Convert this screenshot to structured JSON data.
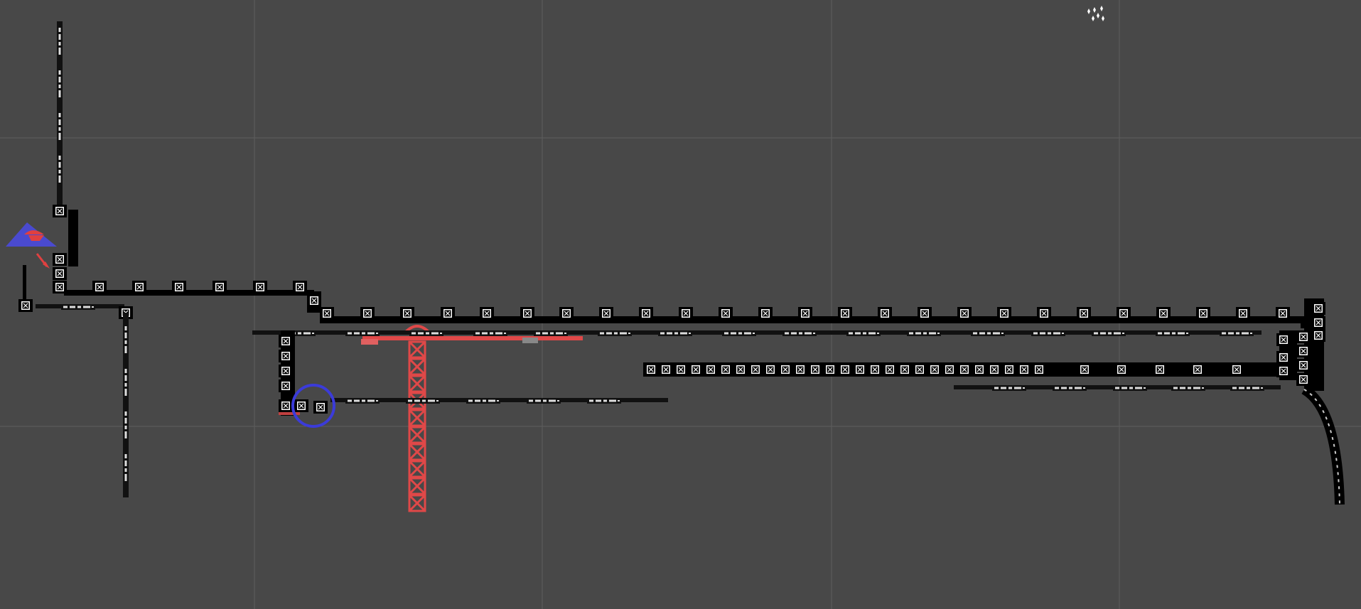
{
  "viewport": {
    "kind": "scene-view",
    "background_color": "#484848",
    "grid_color": "#5e5e5e",
    "grid": true
  },
  "gizmos": {
    "camera_icon": "camera-gizmo-icon",
    "light_icon": "light-gizmo-icon",
    "selection_ring_color": "#3b3bd9",
    "tower_color": "#e04848",
    "node_fill": "#ffffff",
    "rail_color": "#000000"
  }
}
